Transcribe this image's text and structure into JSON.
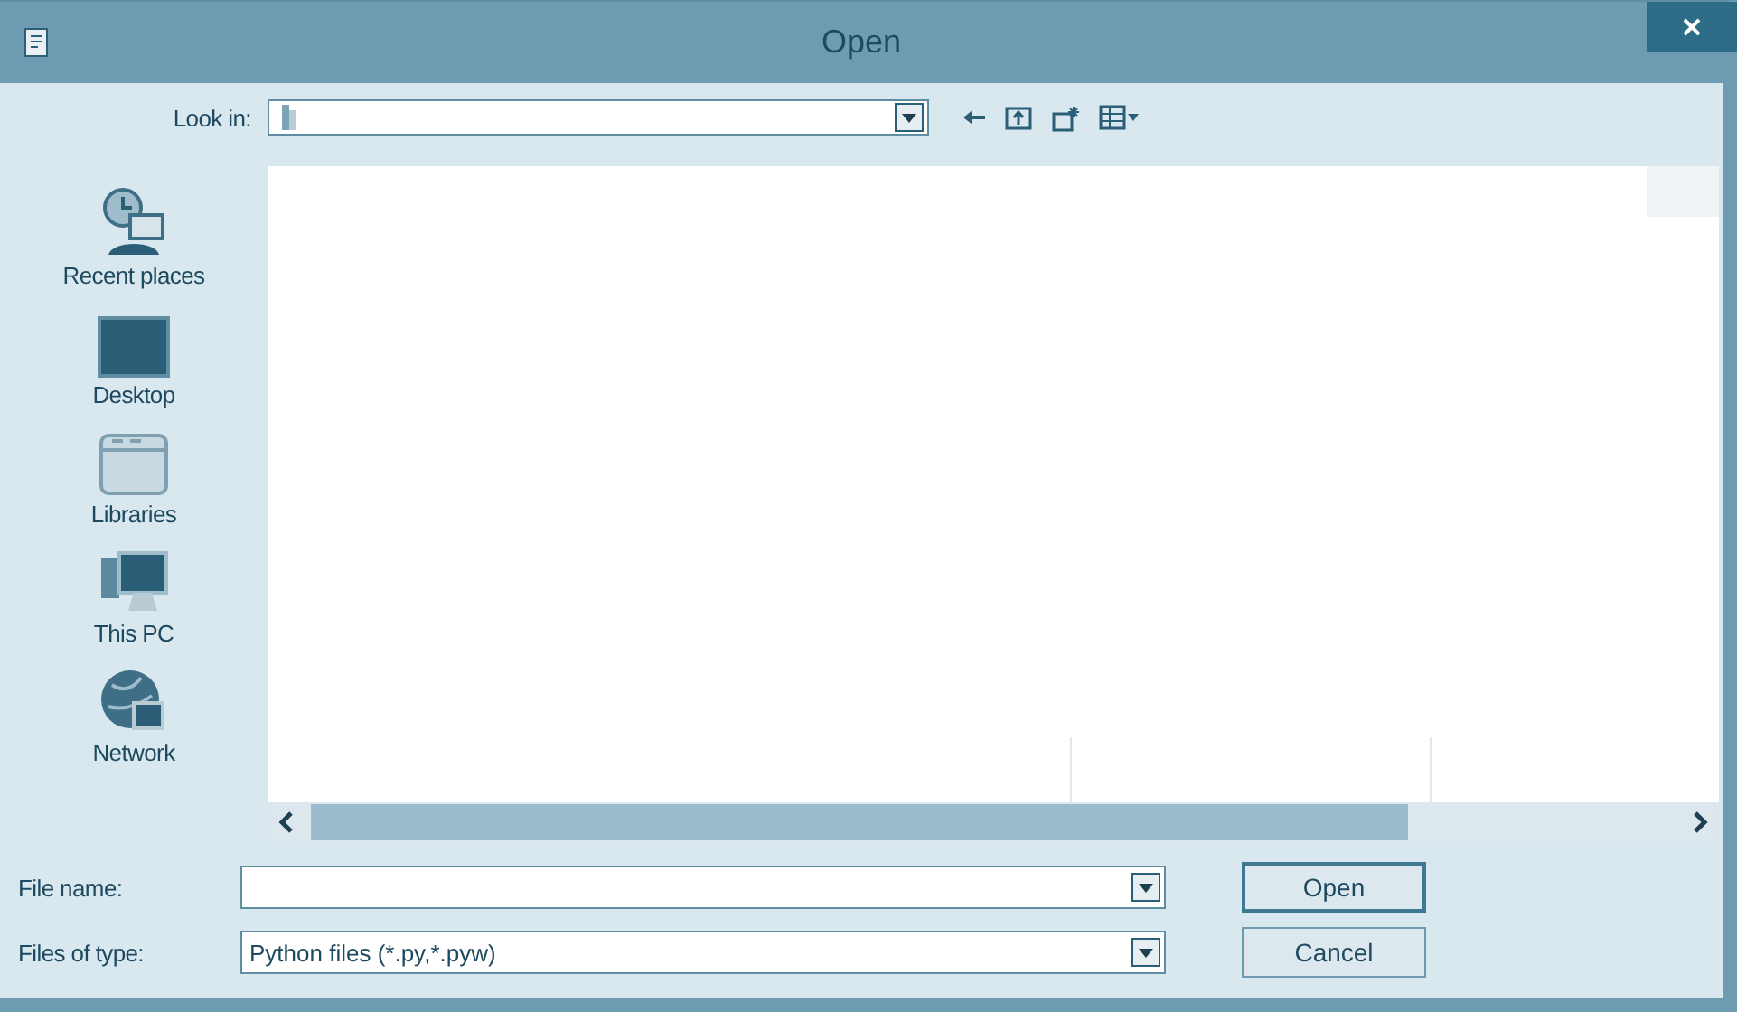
{
  "window": {
    "title": "Open"
  },
  "look_in": {
    "label": "Look in:"
  },
  "sidebar": {
    "items": [
      {
        "label": "Recent places",
        "kind": "recent"
      },
      {
        "label": "Desktop",
        "kind": "desktop"
      },
      {
        "label": "Libraries",
        "kind": "libraries"
      },
      {
        "label": "This PC",
        "kind": "pc"
      },
      {
        "label": "Network",
        "kind": "network"
      }
    ]
  },
  "file_name": {
    "label": "File name:"
  },
  "file_type": {
    "label": "Files of type:",
    "value": "Python files (*.py,*.pyw)"
  },
  "buttons": [
    {
      "label": "Open"
    },
    {
      "label": "Cancel"
    }
  ]
}
